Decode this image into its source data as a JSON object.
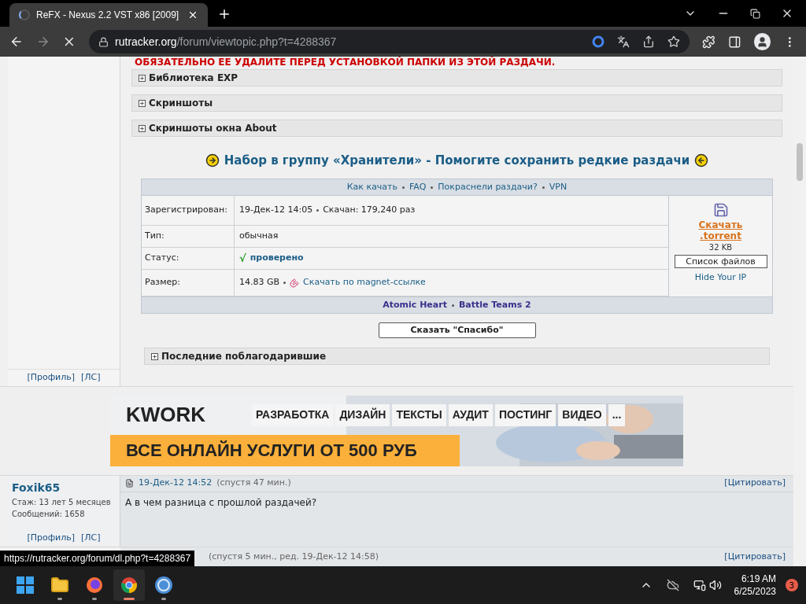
{
  "browser": {
    "tab_title": "ReFX - Nexus 2.2 VST x86 [2009]",
    "url_host": "rutracker.org",
    "url_path": "/forum/viewtopic.php?t=4288367",
    "loading": true
  },
  "post": {
    "warning": "ОБЯЗАТЕЛЬНО ЕЕ УДАЛИТЕ ПЕРЕД УСТАНОВКОЙ ПАПКИ ИЗ ЭТОЙ РАЗДАЧИ.",
    "spoilers": [
      {
        "title": "Библиотека EXP",
        "expanded": false
      },
      {
        "title": "Скриншоты",
        "expanded": false
      },
      {
        "title": "Скриншоты окна About",
        "expanded": false
      }
    ],
    "keepers_banner": "Набор в группу «Хранители» - Помогите сохранить редкие раздачи",
    "help_links": [
      "Как качать",
      "FAQ",
      "Покраснели раздачи?",
      "VPN"
    ],
    "rows": [
      {
        "label": "Зарегистрирован:",
        "value": "19-Дек-12 14:05",
        "extra": "Скачан: 179,240 раз"
      },
      {
        "label": "Тип:",
        "value": "обычная"
      },
      {
        "label": "Статус:",
        "value": "проверено",
        "kind": "status",
        "mark": "√"
      },
      {
        "label": "Размер:",
        "value": "14.83 GB",
        "extra": "Скачать по magnet-ссылке",
        "kind": "magnet"
      }
    ],
    "download": {
      "link": "Скачать .torrent",
      "size": "32 KB",
      "files_button": "Список файлов",
      "hide_ip": "Hide Your IP"
    },
    "ads": [
      "Atomic Heart",
      "Battle Teams 2"
    ],
    "thanks_button": "Сказать \"Спасибо\"",
    "thanked_spoiler": {
      "title": "Последние поблагодарившие",
      "expanded": false
    },
    "author_links": [
      "[Профиль]",
      "[ЛС]"
    ]
  },
  "banner": {
    "logo": "KWORK",
    "menu": [
      "РАЗРАБОТКА",
      "ДИЗАЙН",
      "ТЕКСТЫ",
      "АУДИТ",
      "ПОСТИНГ",
      "ВИДЕО",
      "..."
    ],
    "slogan": "ВСЕ ОНЛАЙН УСЛУГИ ОТ 500 РУБ"
  },
  "reply": {
    "author": "Foxik65",
    "stats": [
      "Стаж: 13 лет 5 месяцев",
      "Сообщений: 1658"
    ],
    "date": "19-Дек-12 14:52",
    "after": "(спустя 47 мин.)",
    "quote": "[Цитировать]",
    "text": "А в чем разница с прошлой раздачей?",
    "author_links": [
      "[Профиль]",
      "[ЛС]"
    ]
  },
  "next_reply": {
    "after": "(спустя 5 мин., ред. 19-Дек-12 14:58)",
    "quote": "[Цитировать]"
  },
  "status_url": "https://rutracker.org/forum/dl.php?t=4288367",
  "taskbar": {
    "time": "6:19 AM",
    "date": "6/25/2023",
    "badge": "3",
    "apps": [
      {
        "kind": "explorer",
        "selected": false
      },
      {
        "kind": "firefox",
        "selected": false
      },
      {
        "kind": "chrome",
        "selected": true
      },
      {
        "kind": "qbittorrent",
        "selected": false
      }
    ]
  }
}
